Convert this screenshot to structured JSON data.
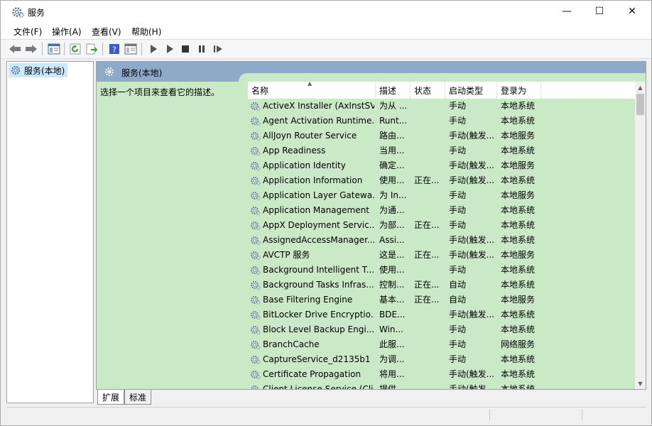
{
  "window": {
    "title": "服务",
    "minimize_glyph": "—",
    "maximize_glyph": "☐",
    "close_glyph": "✕"
  },
  "menu": [
    "文件(F)",
    "操作(A)",
    "查看(V)",
    "帮助(H)"
  ],
  "toolbar": {
    "icons": [
      "back-icon",
      "forward-icon",
      "show-hide-console-tree-icon",
      "refresh-icon",
      "export-list-icon",
      "help-icon",
      "properties-view-icon",
      "start-service-icon",
      "start-service-alt-icon",
      "stop-service-icon",
      "pause-service-icon",
      "restart-service-icon"
    ]
  },
  "tree": {
    "selected_label": "服务(本地)"
  },
  "pane": {
    "title": "服务(本地)",
    "description": "选择一个项目来查看它的描述。"
  },
  "columns": {
    "name": "名称",
    "desc": "描述",
    "state": "状态",
    "startup": "启动类型",
    "logon": "登录为"
  },
  "services": [
    {
      "name": "ActiveX Installer (AxInstSV)",
      "desc": "为从 ...",
      "state": "",
      "startup": "手动",
      "logon": "本地系统"
    },
    {
      "name": "Agent Activation Runtime...",
      "desc": "Runt...",
      "state": "",
      "startup": "手动",
      "logon": "本地系统"
    },
    {
      "name": "AllJoyn Router Service",
      "desc": "路由...",
      "state": "",
      "startup": "手动(触发...",
      "logon": "本地服务"
    },
    {
      "name": "App Readiness",
      "desc": "当用...",
      "state": "",
      "startup": "手动",
      "logon": "本地系统"
    },
    {
      "name": "Application Identity",
      "desc": "确定...",
      "state": "",
      "startup": "手动(触发...",
      "logon": "本地服务"
    },
    {
      "name": "Application Information",
      "desc": "使用...",
      "state": "正在...",
      "startup": "手动(触发...",
      "logon": "本地系统"
    },
    {
      "name": "Application Layer Gatewa...",
      "desc": "为 In...",
      "state": "",
      "startup": "手动",
      "logon": "本地服务"
    },
    {
      "name": "Application Management",
      "desc": "为通...",
      "state": "",
      "startup": "手动",
      "logon": "本地系统"
    },
    {
      "name": "AppX Deployment Servic...",
      "desc": "为部...",
      "state": "正在...",
      "startup": "手动",
      "logon": "本地系统"
    },
    {
      "name": "AssignedAccessManager...",
      "desc": "Assi...",
      "state": "",
      "startup": "手动(触发...",
      "logon": "本地系统"
    },
    {
      "name": "AVCTP 服务",
      "desc": "这是...",
      "state": "正在...",
      "startup": "手动(触发...",
      "logon": "本地服务"
    },
    {
      "name": "Background Intelligent T...",
      "desc": "使用...",
      "state": "",
      "startup": "手动",
      "logon": "本地系统"
    },
    {
      "name": "Background Tasks Infras...",
      "desc": "控制...",
      "state": "正在...",
      "startup": "自动",
      "logon": "本地系统"
    },
    {
      "name": "Base Filtering Engine",
      "desc": "基本...",
      "state": "正在...",
      "startup": "自动",
      "logon": "本地服务"
    },
    {
      "name": "BitLocker Drive Encryptio...",
      "desc": "BDE...",
      "state": "",
      "startup": "手动(触发...",
      "logon": "本地系统"
    },
    {
      "name": "Block Level Backup Engi...",
      "desc": "Win...",
      "state": "",
      "startup": "手动",
      "logon": "本地系统"
    },
    {
      "name": "BranchCache",
      "desc": "此服...",
      "state": "",
      "startup": "手动",
      "logon": "网络服务"
    },
    {
      "name": "CaptureService_d2135b1",
      "desc": "为调...",
      "state": "",
      "startup": "手动",
      "logon": "本地系统"
    },
    {
      "name": "Certificate Propagation",
      "desc": "将用...",
      "state": "",
      "startup": "手动(触发...",
      "logon": "本地系统"
    },
    {
      "name": "Client License Service (Cli...",
      "desc": "提供...",
      "state": "",
      "startup": "手动(触发...",
      "logon": "本地系统"
    }
  ],
  "tabs": [
    "扩展",
    "标准"
  ],
  "colors": {
    "pane_bg": "#c9e9c7",
    "pane_header": "#8fa9c9",
    "tree_selected": "#cce8ff"
  }
}
